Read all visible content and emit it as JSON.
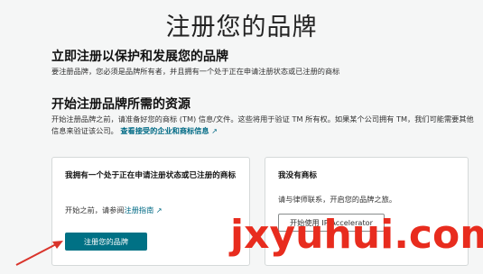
{
  "page": {
    "title": "注册您的品牌"
  },
  "section_protect": {
    "heading": "立即注册以保护和发展您的品牌",
    "body": "要注册品牌，您必须是品牌所有者，并且拥有一个处于正在申请注册状态或已注册的商标"
  },
  "section_resources": {
    "heading": "开始注册品牌所需的资源",
    "body": "开始注册品牌之前，请准备好您的商标 (TM) 信息/文件。这些将用于验证 TM 所有权。如果某个公司拥有 TM，我们可能需要其他信息来验证该公司。",
    "link_label": "查看接受的企业和商标信息"
  },
  "card_have_trademark": {
    "title": "我拥有一个处于正在申请注册状态或已注册的商标",
    "sub_prefix": "开始之前，请参阅",
    "guide_link": "注册指南",
    "button_label": "注册您的品牌"
  },
  "card_no_trademark": {
    "title": "我没有商标",
    "sub": "请与律师联系，开启您的品牌之旅。",
    "button_label": "开始使用 IP Accelerator"
  },
  "watermark": {
    "text": "jxyuhui.com",
    "color": "#e82c1e"
  },
  "colors": {
    "primary_button": "#007185",
    "link": "#006a85",
    "arrow": "#d9342b"
  }
}
